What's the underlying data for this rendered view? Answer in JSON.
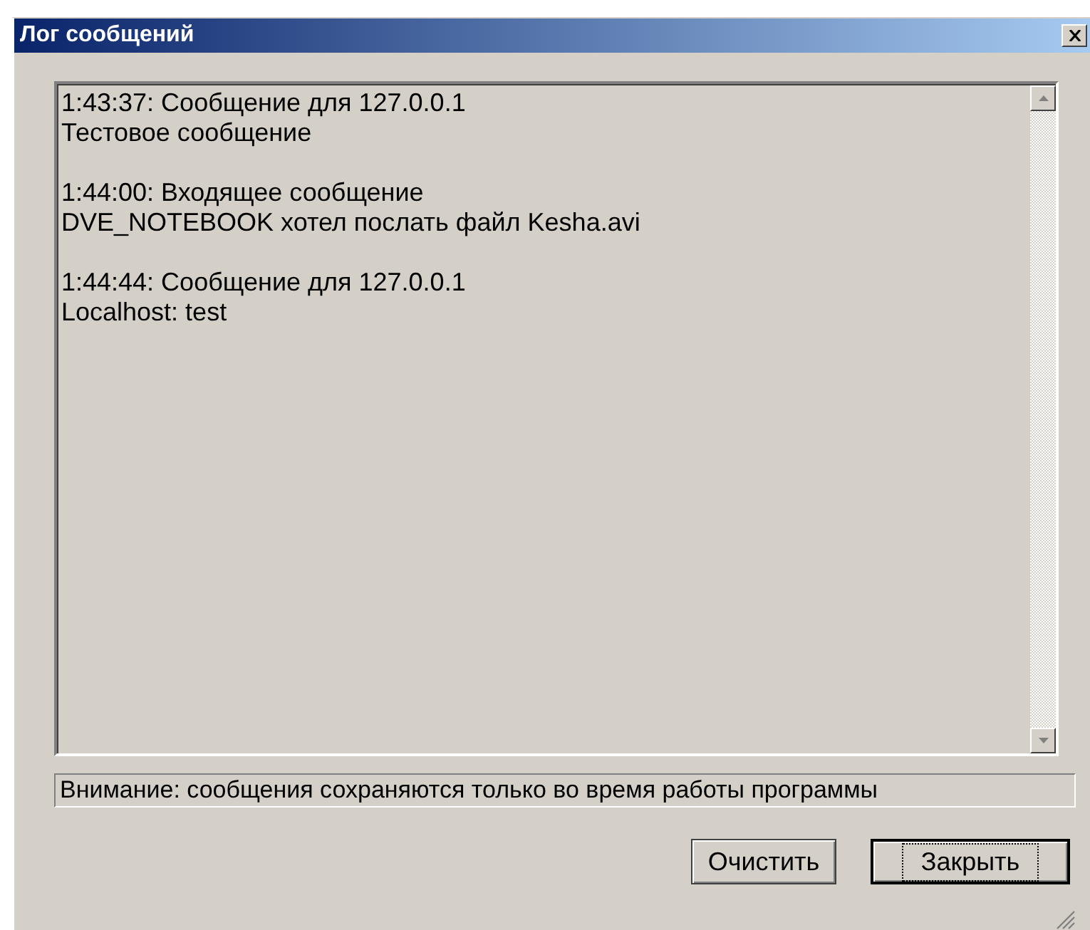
{
  "window": {
    "title": "Лог сообщений"
  },
  "log": [
    {
      "header": "1:43:37: Сообщение для 127.0.0.1",
      "text": "Тестовое сообщение"
    },
    {
      "header": "1:44:00: Входящее сообщение",
      "text": "DVE_NOTEBOOK хотел послать файл Kesha.avi"
    },
    {
      "header": "1:44:44: Сообщение для 127.0.0.1",
      "text": "Localhost: test"
    }
  ],
  "notice": "Внимание: сообщения сохраняются только во время работы программы",
  "buttons": [
    {
      "label": "Очистить",
      "default": false
    },
    {
      "label": "Закрыть",
      "default": true
    }
  ]
}
